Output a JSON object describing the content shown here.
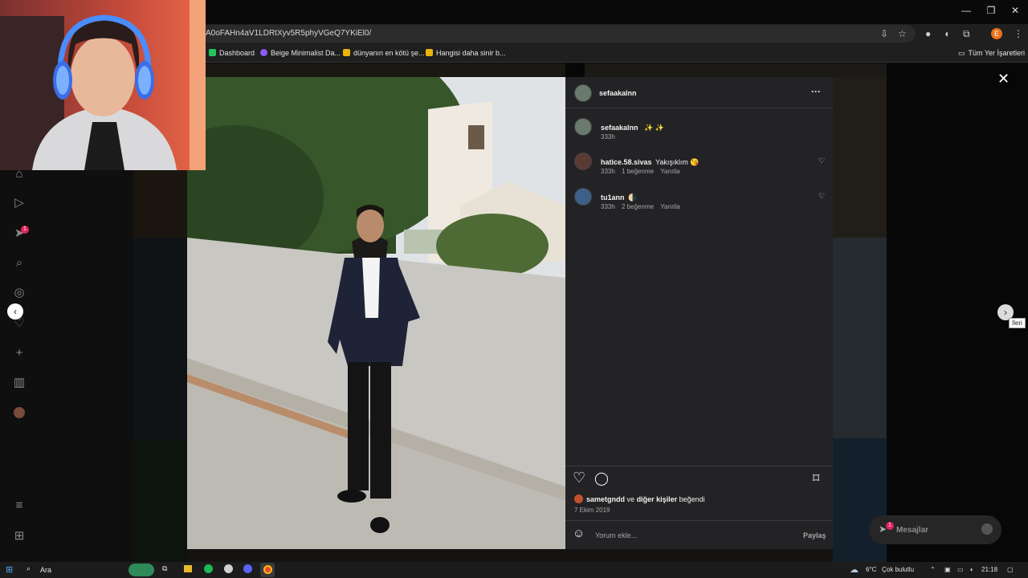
{
  "browser": {
    "url": "A0oFAHn4aV1LDRtXyv5R5phyVGeQ7YKiEl0/",
    "profile_initial": "E",
    "bookmarks": [
      {
        "label": "Dashboard",
        "color": "#22c55e"
      },
      {
        "label": "Beige Minimalist Da...",
        "color": "#8b5cf6"
      },
      {
        "label": "dünyanın en kötü şe...",
        "color": "#eab308"
      },
      {
        "label": "Hangisi daha sinir b...",
        "color": "#eab308"
      }
    ],
    "all_bookmarks": "Tüm Yer İşaretleri"
  },
  "post": {
    "author": "sefaakalnn",
    "caption_user": "sefaakalnn",
    "caption_emoji": "✨ ✨",
    "caption_time": "333h",
    "comments": [
      {
        "user": "hatice.58.sivas",
        "text": "Yakışıklım 😘",
        "time": "333h",
        "likes": "1 beğenme",
        "reply": "Yanıtla"
      },
      {
        "user": "tu1ann",
        "text": "🌗",
        "time": "333h",
        "likes": "2 beğenme",
        "reply": "Yanıtla"
      }
    ],
    "liked_by_user": "sametgndd",
    "liked_by_mid": "ve",
    "liked_by_others": "diğer kişiler",
    "liked_by_end": "beğendi",
    "date": "7 Ekim 2019",
    "comment_placeholder": "Yorum ekle...",
    "share_label": "Paylaş",
    "more_label": "···"
  },
  "nav": {
    "close": "✕",
    "prev": "‹",
    "next": "›",
    "next_tooltip": "İleri",
    "notification_count": "1"
  },
  "messages": {
    "label": "Mesajlar",
    "badge": "1"
  },
  "taskbar": {
    "search": "Ara",
    "weather_temp": "6°C",
    "weather_text": "Çok bulutlu",
    "time": "21:18"
  }
}
